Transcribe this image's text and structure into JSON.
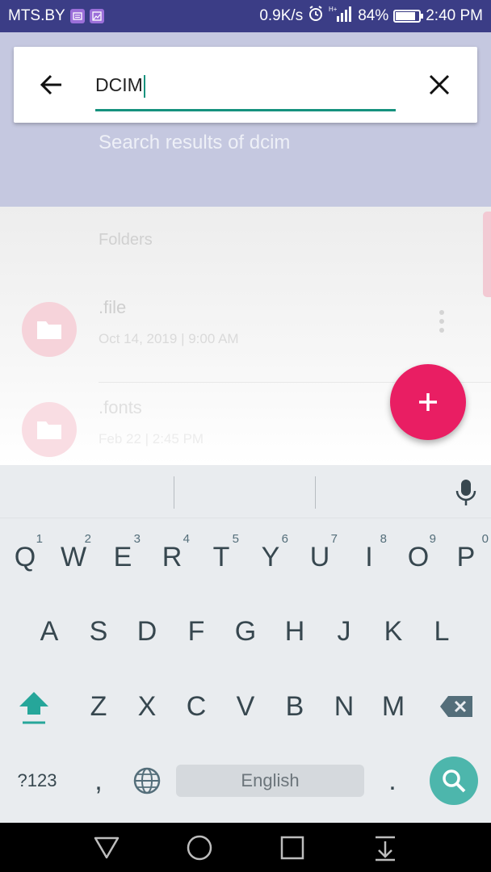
{
  "status_bar": {
    "carrier": "MTS.BY",
    "speed": "0.9K/s",
    "battery_percent": "84%",
    "battery_level": 0.84,
    "time": "2:40 PM",
    "icons": [
      "message-notification-icon",
      "image-notification-icon",
      "alarm-icon",
      "signal-icon",
      "battery-icon"
    ]
  },
  "search": {
    "query": "DCIM",
    "results_caption": "Search results of dcim",
    "icons": [
      "back-arrow-icon",
      "close-icon"
    ]
  },
  "list": {
    "section_label": "Folders",
    "items": [
      {
        "title": ".file",
        "subtitle": "Oct 14, 2019 | 9:00 AM"
      },
      {
        "title": ".fonts",
        "subtitle": "Feb 22 | 2:45 PM"
      }
    ]
  },
  "fab": {
    "icon": "add-icon",
    "color": "#e91e63"
  },
  "keyboard": {
    "row1": [
      {
        "label": "Q",
        "hint": "1"
      },
      {
        "label": "W",
        "hint": "2"
      },
      {
        "label": "E",
        "hint": "3"
      },
      {
        "label": "R",
        "hint": "4"
      },
      {
        "label": "T",
        "hint": "5"
      },
      {
        "label": "Y",
        "hint": "6"
      },
      {
        "label": "U",
        "hint": "7"
      },
      {
        "label": "I",
        "hint": "8"
      },
      {
        "label": "O",
        "hint": "9"
      },
      {
        "label": "P",
        "hint": "0"
      }
    ],
    "row2": [
      "A",
      "S",
      "D",
      "F",
      "G",
      "H",
      "J",
      "K",
      "L"
    ],
    "row3": [
      "Z",
      "X",
      "C",
      "V",
      "B",
      "N",
      "M"
    ],
    "symbols_label": "?123",
    "comma_label": ",",
    "period_label": ".",
    "space_label": "English",
    "accent_color": "#4db6ac"
  },
  "nav_bar": {
    "icons": [
      "back-triangle-icon",
      "home-circle-icon",
      "recents-square-icon",
      "notification-pull-icon"
    ]
  }
}
